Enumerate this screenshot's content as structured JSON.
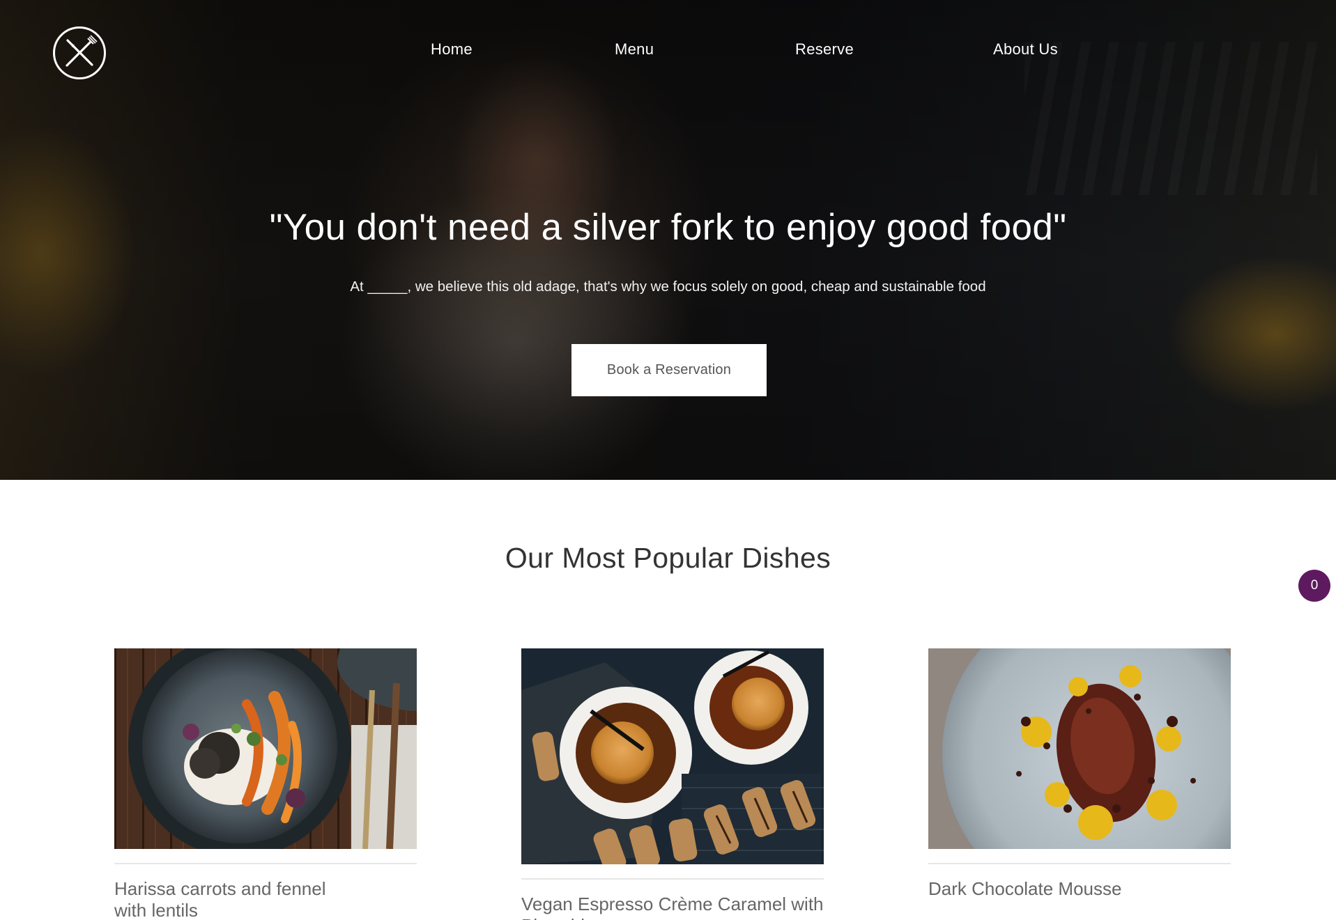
{
  "brand": {
    "logo_icon": "crossed-fork-knife-icon"
  },
  "nav": {
    "items": [
      {
        "label": "Home"
      },
      {
        "label": "Menu"
      },
      {
        "label": "Reserve"
      },
      {
        "label": "About Us"
      }
    ]
  },
  "hero": {
    "quote": "\"You don't need a silver fork to enjoy good food\"",
    "subtitle": "At _____, we believe this old adage, that's why we focus solely on good, cheap and sustainable food",
    "cta_label": "Book a Reservation"
  },
  "popular": {
    "title": "Our Most Popular Dishes",
    "dishes": [
      {
        "name": "Harissa carrots and fennel with lentils",
        "image": "carrots-lentils-plate"
      },
      {
        "name": "Vegan Espresso Crème Caramel with Pistachio",
        "image": "creme-caramel-bowls"
      },
      {
        "name": "Dark Chocolate Mousse",
        "image": "chocolate-mousse-plate"
      }
    ]
  },
  "cart": {
    "count": "0",
    "color": "#5e1a5e"
  }
}
